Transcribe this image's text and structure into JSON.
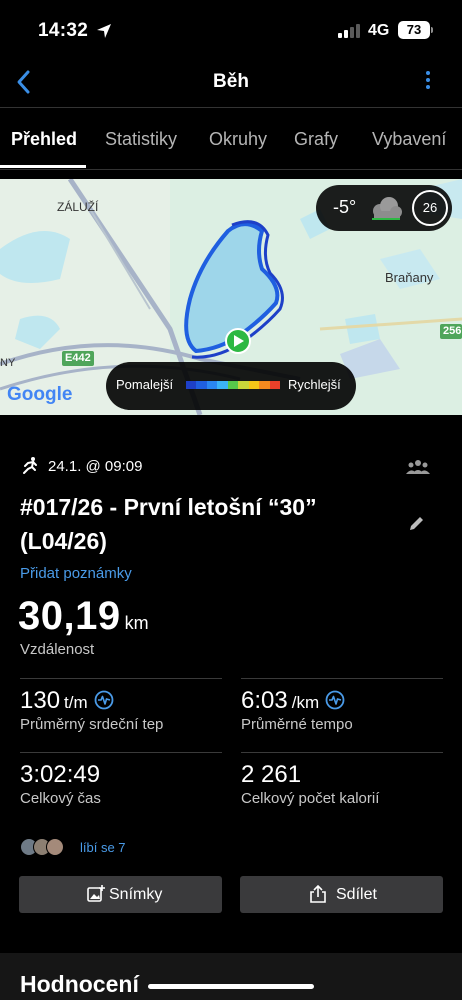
{
  "status_bar": {
    "time": "14:32",
    "network": "4G",
    "battery": "73"
  },
  "nav": {
    "title": "Běh"
  },
  "tabs": [
    "Přehled",
    "Statistiky",
    "Okruhy",
    "Grafy",
    "Vybavení"
  ],
  "map": {
    "labels": {
      "zaluzi": "ZÁLUŽÍ",
      "branany": "Braňany",
      "road_e442": "E442",
      "road_256": "256",
      "ny": "NY",
      "google": "Google"
    },
    "weather": {
      "temperature": "-5°",
      "wind": "26",
      "icon": "cloud-icon"
    },
    "legend": {
      "slow": "Pomalejší",
      "fast": "Rychlejší",
      "colors": [
        "#1e40c8",
        "#1f5fe0",
        "#2a86f0",
        "#3bb3f5",
        "#57c84a",
        "#c9d63a",
        "#f5c518",
        "#f58a1f",
        "#e8402a"
      ]
    }
  },
  "activity": {
    "date": "24.1. @ 09:09",
    "title_line1": "#017/26 - První letošní “30”",
    "title_line2": "(L04/26)",
    "add_notes": "Přidat poznámky",
    "distance_value": "30,19",
    "distance_unit": "km",
    "distance_label": "Vzdálenost"
  },
  "stats": [
    {
      "value": "130",
      "unit": "t/m",
      "label": "Průměrný srdeční tep",
      "icon": "heart-rate-icon"
    },
    {
      "value": "6:03",
      "unit": "/km",
      "label": "Průměrné tempo",
      "icon": "heart-rate-icon"
    },
    {
      "value": "3:02:49",
      "unit": "",
      "label": "Celkový čas"
    },
    {
      "value": "2 261",
      "unit": "",
      "label": "Celkový počet kalorií"
    }
  ],
  "likes": {
    "text": "líbí se 7"
  },
  "buttons": {
    "photos": "Snímky",
    "share": "Sdílet"
  },
  "section": {
    "title": "Hodnocení"
  }
}
